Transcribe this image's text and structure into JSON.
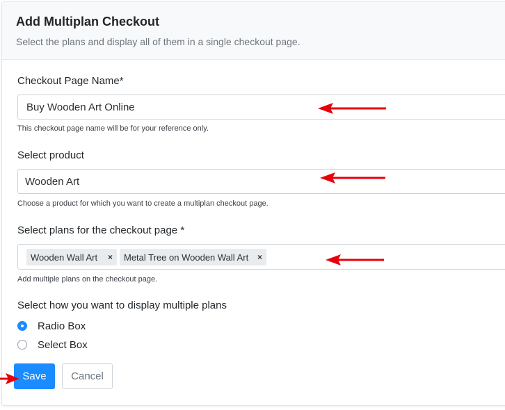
{
  "dialog": {
    "title": "Add Multiplan Checkout",
    "subtitle": "Select the plans and display all of them in a single checkout page."
  },
  "form": {
    "checkout_name": {
      "label": "Checkout Page Name*",
      "value": "Buy Wooden Art Online",
      "help": "This checkout page name will be for your reference only."
    },
    "product": {
      "label": "Select product",
      "value": "Wooden Art",
      "help": "Choose a product for which you want to create a multiplan checkout page."
    },
    "plans": {
      "label": "Select plans for the checkout page *",
      "tags": [
        {
          "label": "Wooden Wall Art",
          "remove": "×"
        },
        {
          "label": "Metal Tree on Wooden Wall Art",
          "remove": "×"
        }
      ],
      "help": "Add multiple plans on the checkout page."
    },
    "display": {
      "label": "Select how you want to display multiple plans",
      "options": [
        {
          "label": "Radio Box",
          "selected": true
        },
        {
          "label": "Select Box",
          "selected": false
        }
      ]
    }
  },
  "buttons": {
    "save": "Save",
    "cancel": "Cancel"
  },
  "colors": {
    "primary": "#1a8cff",
    "annotation_arrow": "#e8000b"
  }
}
